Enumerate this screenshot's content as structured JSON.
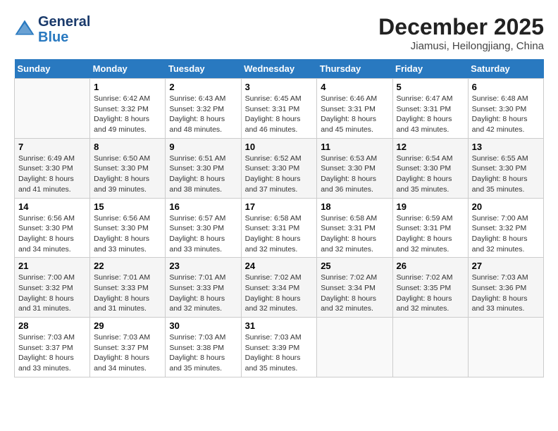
{
  "header": {
    "logo_line1": "General",
    "logo_line2": "Blue",
    "month": "December 2025",
    "location": "Jiamusi, Heilongjiang, China"
  },
  "days_of_week": [
    "Sunday",
    "Monday",
    "Tuesday",
    "Wednesday",
    "Thursday",
    "Friday",
    "Saturday"
  ],
  "weeks": [
    [
      {
        "day": "",
        "info": ""
      },
      {
        "day": "1",
        "info": "Sunrise: 6:42 AM\nSunset: 3:32 PM\nDaylight: 8 hours\nand 49 minutes."
      },
      {
        "day": "2",
        "info": "Sunrise: 6:43 AM\nSunset: 3:32 PM\nDaylight: 8 hours\nand 48 minutes."
      },
      {
        "day": "3",
        "info": "Sunrise: 6:45 AM\nSunset: 3:31 PM\nDaylight: 8 hours\nand 46 minutes."
      },
      {
        "day": "4",
        "info": "Sunrise: 6:46 AM\nSunset: 3:31 PM\nDaylight: 8 hours\nand 45 minutes."
      },
      {
        "day": "5",
        "info": "Sunrise: 6:47 AM\nSunset: 3:31 PM\nDaylight: 8 hours\nand 43 minutes."
      },
      {
        "day": "6",
        "info": "Sunrise: 6:48 AM\nSunset: 3:30 PM\nDaylight: 8 hours\nand 42 minutes."
      }
    ],
    [
      {
        "day": "7",
        "info": "Sunrise: 6:49 AM\nSunset: 3:30 PM\nDaylight: 8 hours\nand 41 minutes."
      },
      {
        "day": "8",
        "info": "Sunrise: 6:50 AM\nSunset: 3:30 PM\nDaylight: 8 hours\nand 39 minutes."
      },
      {
        "day": "9",
        "info": "Sunrise: 6:51 AM\nSunset: 3:30 PM\nDaylight: 8 hours\nand 38 minutes."
      },
      {
        "day": "10",
        "info": "Sunrise: 6:52 AM\nSunset: 3:30 PM\nDaylight: 8 hours\nand 37 minutes."
      },
      {
        "day": "11",
        "info": "Sunrise: 6:53 AM\nSunset: 3:30 PM\nDaylight: 8 hours\nand 36 minutes."
      },
      {
        "day": "12",
        "info": "Sunrise: 6:54 AM\nSunset: 3:30 PM\nDaylight: 8 hours\nand 35 minutes."
      },
      {
        "day": "13",
        "info": "Sunrise: 6:55 AM\nSunset: 3:30 PM\nDaylight: 8 hours\nand 35 minutes."
      }
    ],
    [
      {
        "day": "14",
        "info": "Sunrise: 6:56 AM\nSunset: 3:30 PM\nDaylight: 8 hours\nand 34 minutes."
      },
      {
        "day": "15",
        "info": "Sunrise: 6:56 AM\nSunset: 3:30 PM\nDaylight: 8 hours\nand 33 minutes."
      },
      {
        "day": "16",
        "info": "Sunrise: 6:57 AM\nSunset: 3:30 PM\nDaylight: 8 hours\nand 33 minutes."
      },
      {
        "day": "17",
        "info": "Sunrise: 6:58 AM\nSunset: 3:31 PM\nDaylight: 8 hours\nand 32 minutes."
      },
      {
        "day": "18",
        "info": "Sunrise: 6:58 AM\nSunset: 3:31 PM\nDaylight: 8 hours\nand 32 minutes."
      },
      {
        "day": "19",
        "info": "Sunrise: 6:59 AM\nSunset: 3:31 PM\nDaylight: 8 hours\nand 32 minutes."
      },
      {
        "day": "20",
        "info": "Sunrise: 7:00 AM\nSunset: 3:32 PM\nDaylight: 8 hours\nand 32 minutes."
      }
    ],
    [
      {
        "day": "21",
        "info": "Sunrise: 7:00 AM\nSunset: 3:32 PM\nDaylight: 8 hours\nand 31 minutes."
      },
      {
        "day": "22",
        "info": "Sunrise: 7:01 AM\nSunset: 3:33 PM\nDaylight: 8 hours\nand 31 minutes."
      },
      {
        "day": "23",
        "info": "Sunrise: 7:01 AM\nSunset: 3:33 PM\nDaylight: 8 hours\nand 32 minutes."
      },
      {
        "day": "24",
        "info": "Sunrise: 7:02 AM\nSunset: 3:34 PM\nDaylight: 8 hours\nand 32 minutes."
      },
      {
        "day": "25",
        "info": "Sunrise: 7:02 AM\nSunset: 3:34 PM\nDaylight: 8 hours\nand 32 minutes."
      },
      {
        "day": "26",
        "info": "Sunrise: 7:02 AM\nSunset: 3:35 PM\nDaylight: 8 hours\nand 32 minutes."
      },
      {
        "day": "27",
        "info": "Sunrise: 7:03 AM\nSunset: 3:36 PM\nDaylight: 8 hours\nand 33 minutes."
      }
    ],
    [
      {
        "day": "28",
        "info": "Sunrise: 7:03 AM\nSunset: 3:37 PM\nDaylight: 8 hours\nand 33 minutes."
      },
      {
        "day": "29",
        "info": "Sunrise: 7:03 AM\nSunset: 3:37 PM\nDaylight: 8 hours\nand 34 minutes."
      },
      {
        "day": "30",
        "info": "Sunrise: 7:03 AM\nSunset: 3:38 PM\nDaylight: 8 hours\nand 35 minutes."
      },
      {
        "day": "31",
        "info": "Sunrise: 7:03 AM\nSunset: 3:39 PM\nDaylight: 8 hours\nand 35 minutes."
      },
      {
        "day": "",
        "info": ""
      },
      {
        "day": "",
        "info": ""
      },
      {
        "day": "",
        "info": ""
      }
    ]
  ]
}
